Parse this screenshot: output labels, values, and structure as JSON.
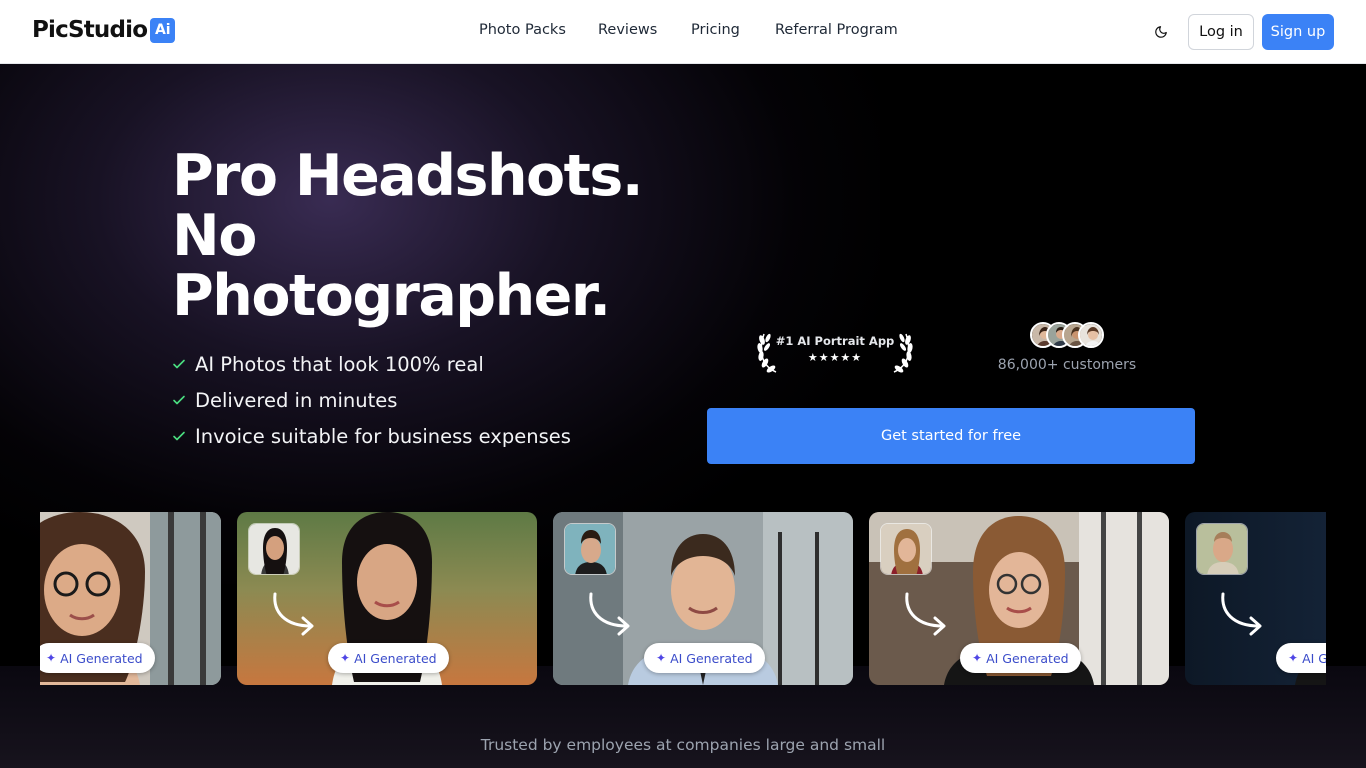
{
  "nav": {
    "logo_text": "PicStudio",
    "logo_badge": "Ai",
    "links": [
      "Photo Packs",
      "Reviews",
      "Pricing",
      "Referral Program"
    ],
    "theme_icon": "moon-icon",
    "login_label": "Log in",
    "signup_label": "Sign up"
  },
  "hero": {
    "headline": "Pro Headshots. No Photographer.",
    "features": [
      "AI Photos that look 100% real",
      "Delivered in minutes",
      "Invoice suitable for business expenses"
    ],
    "award_title": "#1 AI Portrait App",
    "award_stars": "★★★★★",
    "customers_label": "86,000+ customers",
    "cta_label": "Get started for free"
  },
  "gallery": {
    "badge_label": "AI Generated",
    "card_count_visible": 5
  },
  "trusted_label": "Trusted by employees at companies large and small",
  "colors": {
    "accent": "#3b82f6",
    "hero_bg": "#000000",
    "glow": "#4c3a6e",
    "muted_text": "#9ca3af"
  }
}
